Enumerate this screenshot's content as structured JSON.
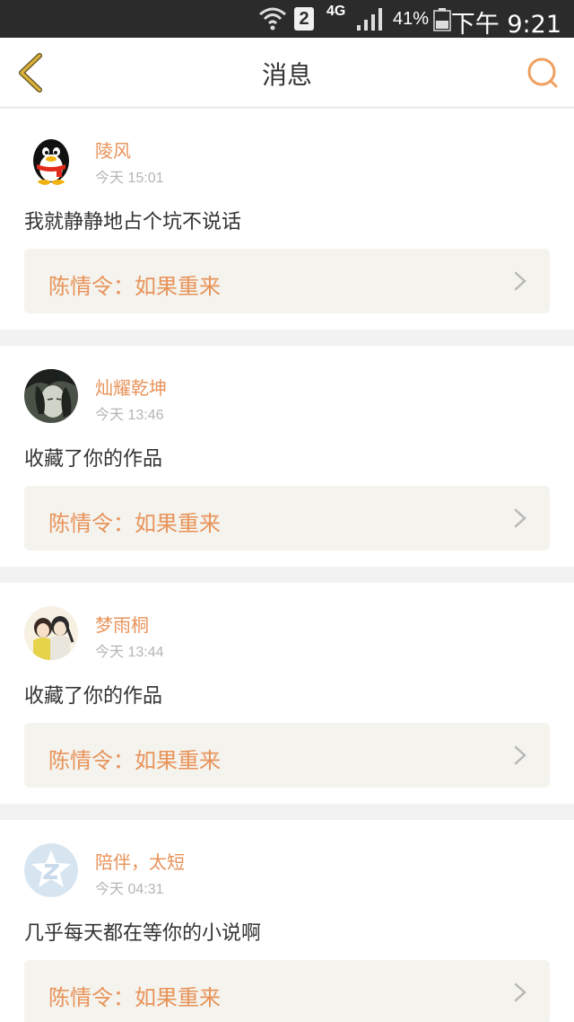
{
  "status_bar": {
    "sim_slot": "2",
    "network": "4G",
    "battery": "41%",
    "time": "下午 9:21"
  },
  "nav": {
    "title": "消息",
    "back_icon": "chevron-left-icon",
    "search_icon": "search-icon"
  },
  "colors": {
    "accent": "#e8935a",
    "back_arrow": "#c9a233",
    "card_bg": "#f4f3ed",
    "page_bg": "#f2f2f2"
  },
  "messages": [
    {
      "user": "陵风",
      "avatar": "penguin-avatar",
      "time": "今天 15:01",
      "text": "我就静静地占个坑不说话",
      "work": "陈情令：如果重来"
    },
    {
      "user": "灿耀乾坤",
      "avatar": "anime-boy-avatar",
      "time": "今天 13:46",
      "text": "收藏了你的作品",
      "work": "陈情令：如果重来"
    },
    {
      "user": "梦雨桐",
      "avatar": "anime-couple-avatar",
      "time": "今天 13:44",
      "text": "收藏了你的作品",
      "work": "陈情令：如果重来"
    },
    {
      "user": "陪伴，太短",
      "avatar": "default-z-avatar",
      "time": "今天 04:31",
      "text": "几乎每天都在等你的小说啊",
      "work": "陈情令：如果重来"
    }
  ]
}
